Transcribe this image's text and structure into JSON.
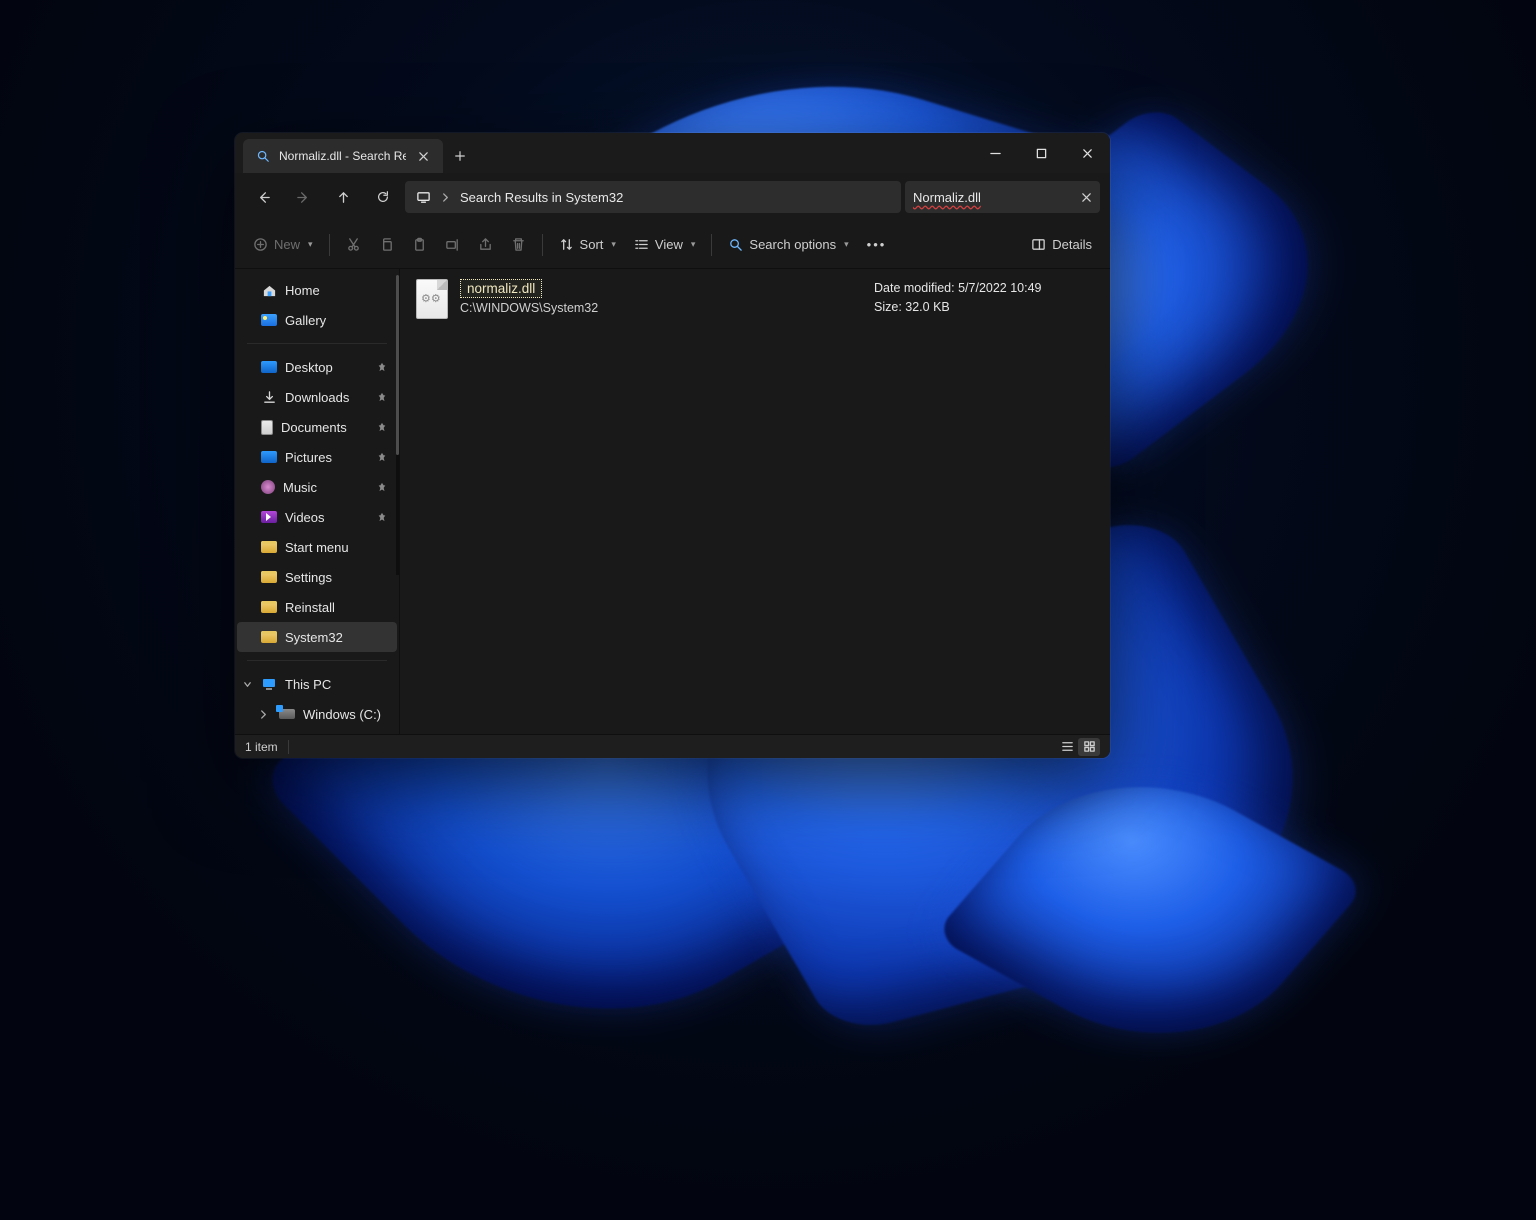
{
  "titlebar": {
    "tab_title": "Normaliz.dll - Search Results in"
  },
  "nav": {
    "breadcrumb": "Search Results in System32",
    "search_query": "Normaliz.dll"
  },
  "toolbar": {
    "new_label": "New",
    "sort_label": "Sort",
    "view_label": "View",
    "search_options_label": "Search options",
    "details_label": "Details"
  },
  "sidebar": {
    "home": "Home",
    "gallery": "Gallery",
    "quick": [
      {
        "icon": "desktop",
        "label": "Desktop",
        "pinned": true
      },
      {
        "icon": "download",
        "label": "Downloads",
        "pinned": true
      },
      {
        "icon": "doc",
        "label": "Documents",
        "pinned": true
      },
      {
        "icon": "pic",
        "label": "Pictures",
        "pinned": true
      },
      {
        "icon": "music",
        "label": "Music",
        "pinned": true
      },
      {
        "icon": "video",
        "label": "Videos",
        "pinned": true
      },
      {
        "icon": "folder",
        "label": "Start menu",
        "pinned": false
      },
      {
        "icon": "folder",
        "label": "Settings",
        "pinned": false
      },
      {
        "icon": "folder",
        "label": "Reinstall",
        "pinned": false
      },
      {
        "icon": "folder",
        "label": "System32",
        "pinned": false,
        "selected": true
      }
    ],
    "this_pc": "This PC",
    "drive": "Windows (C:)"
  },
  "result": {
    "name": "normaliz.dll",
    "path": "C:\\WINDOWS\\System32",
    "modified_label": "Date modified:",
    "modified_value": "5/7/2022 10:49",
    "size_label": "Size:",
    "size_value": "32.0 KB"
  },
  "status": {
    "count": "1 item"
  }
}
